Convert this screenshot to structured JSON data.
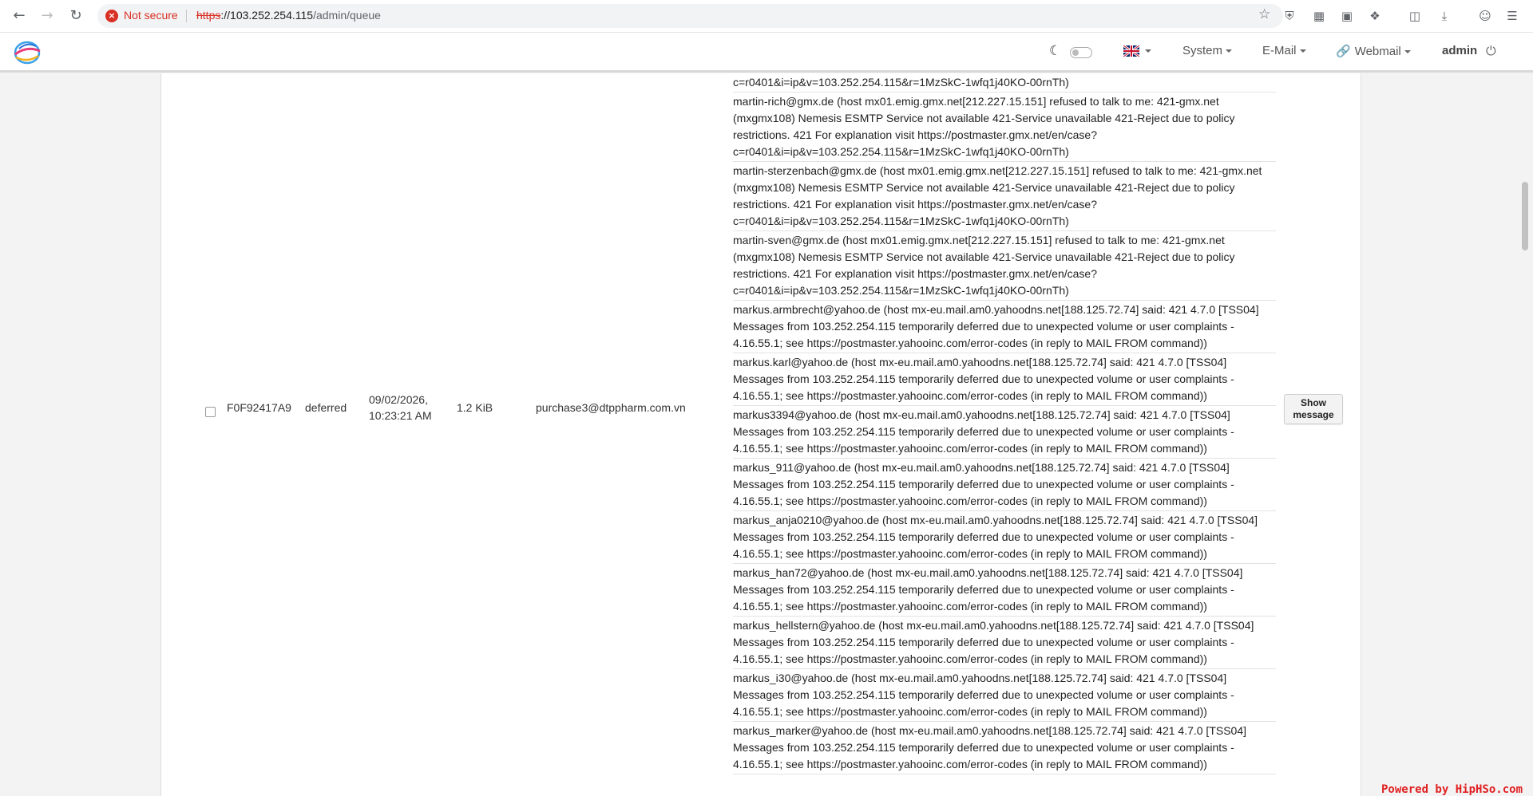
{
  "browser": {
    "security_label": "Not secure",
    "url_scheme": "https",
    "url_host": "://103.252.254.115",
    "url_path": "/admin/queue"
  },
  "header": {
    "menus": [
      "System",
      "E-Mail",
      "Webmail"
    ],
    "user": "admin"
  },
  "queue_row": {
    "id": "F0F92417A9",
    "status": "deferred",
    "date": "09/02/2026,",
    "time": "10:23:21 AM",
    "size": "1.2 KiB",
    "sender": "purchase3@dtppharm.com.vn",
    "show_button": "Show message"
  },
  "recipients": [
    "c=r0401&i=ip&v=103.252.254.115&r=1MzSkC-1wfq1j40KO-00rnTh)",
    "martin-rich@gmx.de (host mx01.emig.gmx.net[212.227.15.151] refused to talk to me: 421-gmx.net (mxgmx108) Nemesis ESMTP Service not available 421-Service unavailable 421-Reject due to policy restrictions. 421 For explanation visit https://postmaster.gmx.net/en/case?c=r0401&i=ip&v=103.252.254.115&r=1MzSkC-1wfq1j40KO-00rnTh)",
    "martin-sterzenbach@gmx.de (host mx01.emig.gmx.net[212.227.15.151] refused to talk to me: 421-gmx.net (mxgmx108) Nemesis ESMTP Service not available 421-Service unavailable 421-Reject due to policy restrictions. 421 For explanation visit https://postmaster.gmx.net/en/case?c=r0401&i=ip&v=103.252.254.115&r=1MzSkC-1wfq1j40KO-00rnTh)",
    "martin-sven@gmx.de (host mx01.emig.gmx.net[212.227.15.151] refused to talk to me: 421-gmx.net (mxgmx108) Nemesis ESMTP Service not available 421-Service unavailable 421-Reject due to policy restrictions. 421 For explanation visit https://postmaster.gmx.net/en/case?c=r0401&i=ip&v=103.252.254.115&r=1MzSkC-1wfq1j40KO-00rnTh)",
    "markus.armbrecht@yahoo.de (host mx-eu.mail.am0.yahoodns.net[188.125.72.74] said: 421 4.7.0 [TSS04] Messages from 103.252.254.115 temporarily deferred due to unexpected volume or user complaints - 4.16.55.1; see https://postmaster.yahooinc.com/error-codes (in reply to MAIL FROM command))",
    "markus.karl@yahoo.de (host mx-eu.mail.am0.yahoodns.net[188.125.72.74] said: 421 4.7.0 [TSS04] Messages from 103.252.254.115 temporarily deferred due to unexpected volume or user complaints - 4.16.55.1; see https://postmaster.yahooinc.com/error-codes (in reply to MAIL FROM command))",
    "markus3394@yahoo.de (host mx-eu.mail.am0.yahoodns.net[188.125.72.74] said: 421 4.7.0 [TSS04] Messages from 103.252.254.115 temporarily deferred due to unexpected volume or user complaints - 4.16.55.1; see https://postmaster.yahooinc.com/error-codes (in reply to MAIL FROM command))",
    "markus_911@yahoo.de (host mx-eu.mail.am0.yahoodns.net[188.125.72.74] said: 421 4.7.0 [TSS04] Messages from 103.252.254.115 temporarily deferred due to unexpected volume or user complaints - 4.16.55.1; see https://postmaster.yahooinc.com/error-codes (in reply to MAIL FROM command))",
    "markus_anja0210@yahoo.de (host mx-eu.mail.am0.yahoodns.net[188.125.72.74] said: 421 4.7.0 [TSS04] Messages from 103.252.254.115 temporarily deferred due to unexpected volume or user complaints - 4.16.55.1; see https://postmaster.yahooinc.com/error-codes (in reply to MAIL FROM command))",
    "markus_han72@yahoo.de (host mx-eu.mail.am0.yahoodns.net[188.125.72.74] said: 421 4.7.0 [TSS04] Messages from 103.252.254.115 temporarily deferred due to unexpected volume or user complaints - 4.16.55.1; see https://postmaster.yahooinc.com/error-codes (in reply to MAIL FROM command))",
    "markus_hellstern@yahoo.de (host mx-eu.mail.am0.yahoodns.net[188.125.72.74] said: 421 4.7.0 [TSS04] Messages from 103.252.254.115 temporarily deferred due to unexpected volume or user complaints - 4.16.55.1; see https://postmaster.yahooinc.com/error-codes (in reply to MAIL FROM command))",
    "markus_i30@yahoo.de (host mx-eu.mail.am0.yahoodns.net[188.125.72.74] said: 421 4.7.0 [TSS04] Messages from 103.252.254.115 temporarily deferred due to unexpected volume or user complaints - 4.16.55.1; see https://postmaster.yahooinc.com/error-codes (in reply to MAIL FROM command))",
    "markus_marker@yahoo.de (host mx-eu.mail.am0.yahoodns.net[188.125.72.74] said: 421 4.7.0 [TSS04] Messages from 103.252.254.115 temporarily deferred due to unexpected volume or user complaints - 4.16.55.1; see https://postmaster.yahooinc.com/error-codes (in reply to MAIL FROM command))"
  ],
  "watermark": "Powered by HipHSo.com",
  "colors": {
    "danger": "#d93025",
    "accent": "#e02020"
  }
}
